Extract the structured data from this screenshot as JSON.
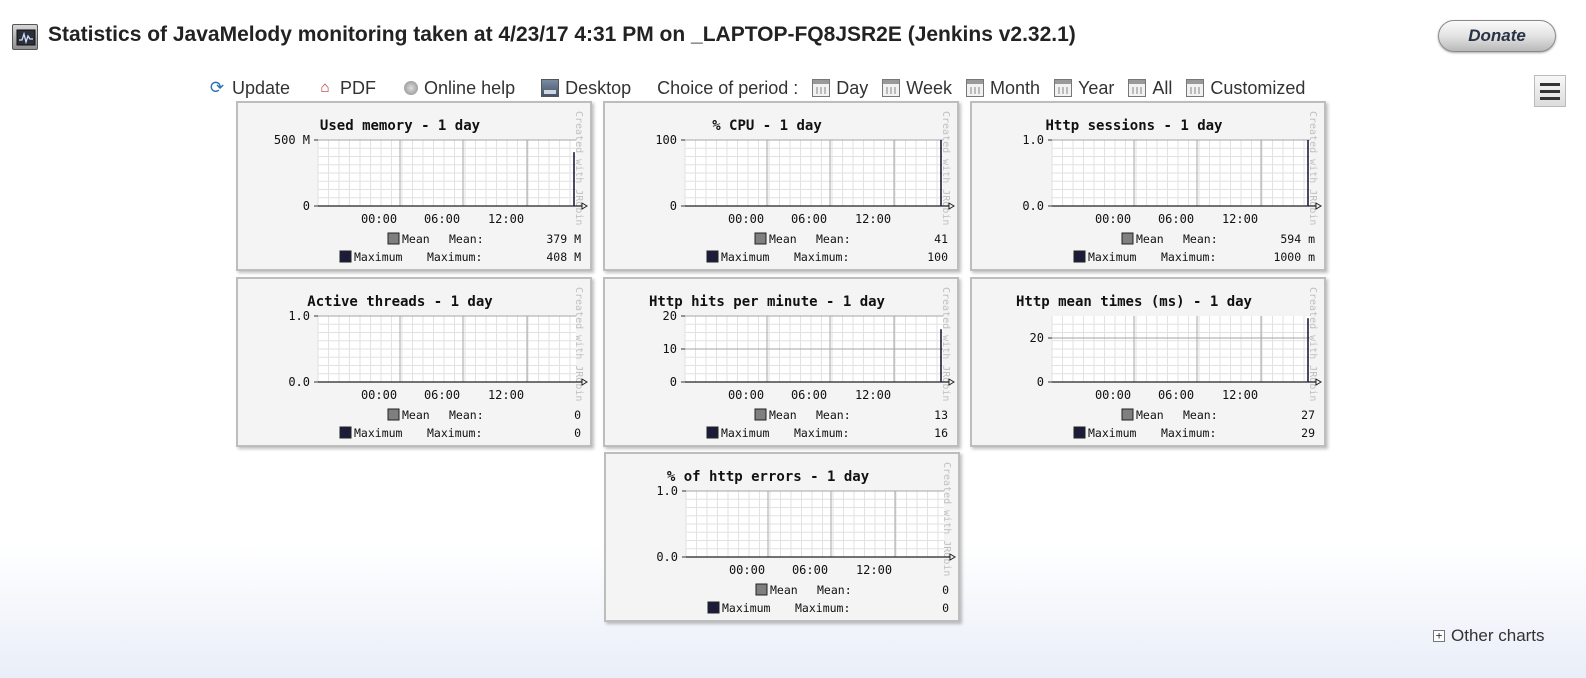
{
  "header": {
    "title": "Statistics of JavaMelody monitoring taken at 4/23/17 4:31 PM on _LAPTOP-FQ8JSR2E (Jenkins v2.32.1)",
    "donate_label": "Donate"
  },
  "toolbar": {
    "update": "Update",
    "pdf": "PDF",
    "online_help": "Online help",
    "desktop": "Desktop",
    "period_label": "Choice of period :",
    "periods": [
      "Day",
      "Week",
      "Month",
      "Year",
      "All",
      "Customized"
    ]
  },
  "watermark": "Created with JRobin",
  "x_ticks": [
    "00:00",
    "06:00",
    "12:00"
  ],
  "chart_data": [
    {
      "type": "area",
      "title": "Used memory - 1 day",
      "ylim": [
        0,
        500
      ],
      "ytick_values": [
        0,
        500
      ],
      "ytick_labels": [
        "0",
        "500 M"
      ],
      "spike_value": 408,
      "legend": [
        {
          "name": "Mean",
          "label": "Mean:",
          "value": "379 M"
        },
        {
          "name": "Maximum",
          "label": "Maximum:",
          "value": "408 M"
        }
      ]
    },
    {
      "type": "area",
      "title": "% CPU - 1 day",
      "ylim": [
        0,
        100
      ],
      "ytick_values": [
        0,
        100
      ],
      "ytick_labels": [
        "0",
        "100"
      ],
      "spike_value": 100,
      "legend": [
        {
          "name": "Mean",
          "label": "Mean:",
          "value": "41"
        },
        {
          "name": "Maximum",
          "label": "Maximum:",
          "value": "100"
        }
      ]
    },
    {
      "type": "area",
      "title": "Http sessions - 1 day",
      "ylim": [
        0,
        1
      ],
      "ytick_values": [
        0,
        1
      ],
      "ytick_labels": [
        "0.0",
        "1.0"
      ],
      "spike_value": 1,
      "legend": [
        {
          "name": "Mean",
          "label": "Mean:",
          "value": "594 m"
        },
        {
          "name": "Maximum",
          "label": "Maximum:",
          "value": "1000 m"
        }
      ]
    },
    {
      "type": "area",
      "title": "Active threads - 1 day",
      "ylim": [
        0,
        1
      ],
      "ytick_values": [
        0,
        1
      ],
      "ytick_labels": [
        "0.0",
        "1.0"
      ],
      "spike_value": 0,
      "legend": [
        {
          "name": "Mean",
          "label": "Mean:",
          "value": "0"
        },
        {
          "name": "Maximum",
          "label": "Maximum:",
          "value": "0"
        }
      ]
    },
    {
      "type": "area",
      "title": "Http hits per minute - 1 day",
      "ylim": [
        0,
        20
      ],
      "ytick_values": [
        0,
        10,
        20
      ],
      "ytick_labels": [
        "0",
        "10",
        "20"
      ],
      "spike_value": 16,
      "legend": [
        {
          "name": "Mean",
          "label": "Mean:",
          "value": "13"
        },
        {
          "name": "Maximum",
          "label": "Maximum:",
          "value": "16"
        }
      ]
    },
    {
      "type": "area",
      "title": "Http mean times (ms) - 1 day",
      "ylim": [
        0,
        30
      ],
      "ytick_values": [
        0,
        20
      ],
      "ytick_labels": [
        "0",
        "20"
      ],
      "spike_value": 29,
      "legend": [
        {
          "name": "Mean",
          "label": "Mean:",
          "value": "27"
        },
        {
          "name": "Maximum",
          "label": "Maximum:",
          "value": "29"
        }
      ]
    },
    {
      "type": "area",
      "title": "% of http errors - 1 day",
      "ylim": [
        0,
        1
      ],
      "ytick_values": [
        0,
        1
      ],
      "ytick_labels": [
        "0.0",
        "1.0"
      ],
      "spike_value": 0,
      "legend": [
        {
          "name": "Mean",
          "label": "Mean:",
          "value": "0"
        },
        {
          "name": "Maximum",
          "label": "Maximum:",
          "value": "0"
        }
      ]
    }
  ],
  "colors": {
    "mean": "#7f7f7f",
    "maximum": "#1c1c3a",
    "grid_major": "#a6a6a6",
    "grid_minor": "#e2e2e2"
  },
  "footer": {
    "other_charts": "Other charts"
  }
}
